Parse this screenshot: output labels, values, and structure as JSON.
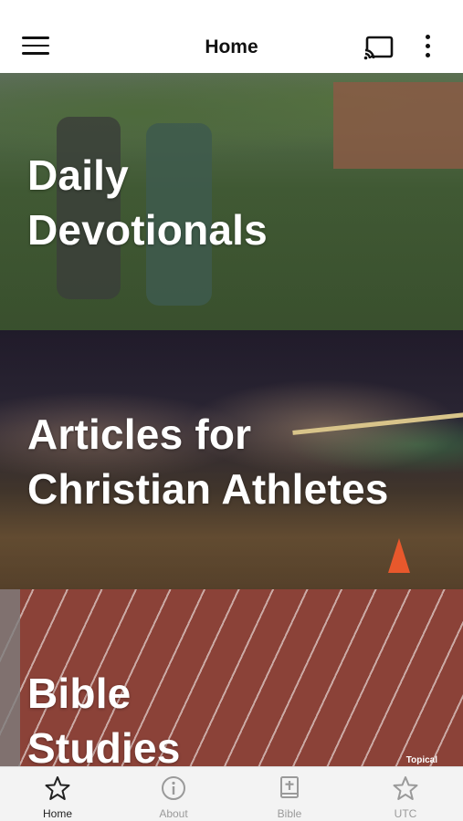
{
  "app_bar": {
    "title": "Home"
  },
  "icons": {
    "menu": "hamburger-menu-icon",
    "cast": "cast-icon",
    "more": "more-vertical-icon",
    "home": "star-icon",
    "about": "info-icon",
    "bible": "bible-book-icon",
    "utc": "star-icon"
  },
  "panels": [
    {
      "line1": "Daily",
      "line2": "Devotionals"
    },
    {
      "line1": "Articles for",
      "line2": "Christian Athletes"
    },
    {
      "line1": "Bible",
      "line2": "Studies",
      "watermark": "Topical"
    }
  ],
  "bottom_nav": {
    "items": [
      {
        "label": "Home",
        "active": true
      },
      {
        "label": "About",
        "active": false
      },
      {
        "label": "Bible",
        "active": false
      },
      {
        "label": "UTC",
        "active": false
      }
    ]
  },
  "colors": {
    "active_icon": "#222222",
    "inactive_icon": "#9a9a9a",
    "nav_background": "#f3f3f3"
  }
}
